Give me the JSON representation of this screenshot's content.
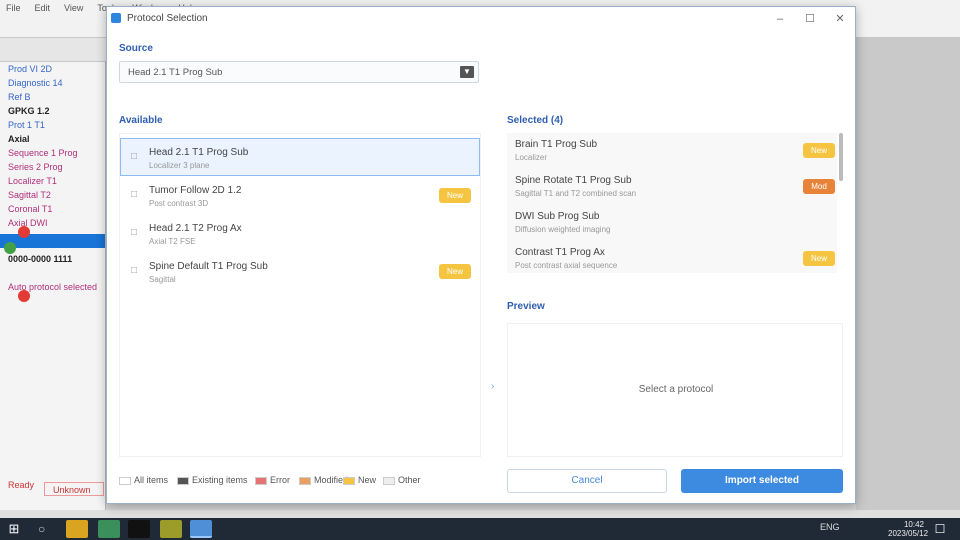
{
  "background_app": {
    "menu": [
      "File",
      "Edit",
      "View",
      "Tools",
      "Window",
      "Help"
    ],
    "left_lines": [
      {
        "text": "Prod VI 2D",
        "style": "blue"
      },
      {
        "text": "Diagnostic 14",
        "style": "blue"
      },
      {
        "text": "Ref B",
        "style": "blue"
      },
      {
        "text": "GPKG 1.2",
        "style": "dark"
      },
      {
        "text": "Prot 1 T1",
        "style": "blue"
      },
      {
        "text": "Axial",
        "style": "dark"
      },
      {
        "text": "Sequence 1 Prog",
        "style": "pink"
      },
      {
        "text": "Series 2 Prog",
        "style": "pink"
      },
      {
        "text": "Localizer T1",
        "style": "pink"
      },
      {
        "text": "Sagittal T2",
        "style": "pink"
      },
      {
        "text": "Coronal T1",
        "style": "pink"
      },
      {
        "text": "Axial DWI",
        "style": "pink"
      }
    ],
    "left_after_sel": "0000-0000 1111",
    "left_bottom": "Auto protocol selected",
    "status_left": "Ready",
    "status_mid": "Unknown"
  },
  "dialog": {
    "title": "Protocol Selection",
    "section_source": "Source",
    "select_value": "Head 2.1 T1 Prog Sub",
    "section_available": "Available",
    "section_selected": "Selected (4)",
    "section_preview": "Preview",
    "preview_empty": "Select a protocol",
    "items_left": [
      {
        "title": "Head 2.1 T1 Prog Sub",
        "sub": "Localizer 3 plane",
        "badge": "",
        "badge_color": "",
        "selected": true
      },
      {
        "title": "Tumor Follow 2D 1.2",
        "sub": "Post contrast 3D",
        "badge": "New",
        "badge_color": "yellow",
        "selected": false
      },
      {
        "title": "Head 2.1 T2 Prog Ax",
        "sub": "Axial T2 FSE",
        "badge": "",
        "badge_color": "",
        "selected": false
      },
      {
        "title": "Spine Default T1 Prog Sub",
        "sub": "Sagittal",
        "badge": "New",
        "badge_color": "yellow",
        "selected": false
      }
    ],
    "items_right": [
      {
        "title": "Brain T1 Prog Sub",
        "sub": "Localizer",
        "badge": "New",
        "badge_color": "yellow"
      },
      {
        "title": "Spine Rotate T1 Prog Sub",
        "sub": "Sagittal T1 and T2 combined scan",
        "badge": "Mod",
        "badge_color": "orange"
      },
      {
        "title": "DWI Sub Prog Sub",
        "sub": "Diffusion weighted imaging",
        "badge": "",
        "badge_color": ""
      },
      {
        "title": "Contrast T1 Prog Ax",
        "sub": "Post contrast axial sequence",
        "badge": "New",
        "badge_color": "yellow"
      }
    ],
    "legend": [
      {
        "label": "All items",
        "color": "#ffffff"
      },
      {
        "label": "Existing items",
        "color": "#555555"
      },
      {
        "label": "Error",
        "color": "#e57373"
      },
      {
        "label": "Modified",
        "color": "#e8a060"
      },
      {
        "label": "New",
        "color": "#f5c542"
      },
      {
        "label": "Other",
        "color": "#eeeeee"
      }
    ],
    "btn_cancel": "Cancel",
    "btn_ok": "Import selected"
  },
  "taskbar": {
    "tray": "ENG",
    "time": "10:42",
    "date": "2023/05/12"
  },
  "colors": {
    "accent": "#3d8be0",
    "badge_yellow": "#f5c542",
    "badge_orange": "#e8843a",
    "selection_blue": "#1874d6"
  }
}
